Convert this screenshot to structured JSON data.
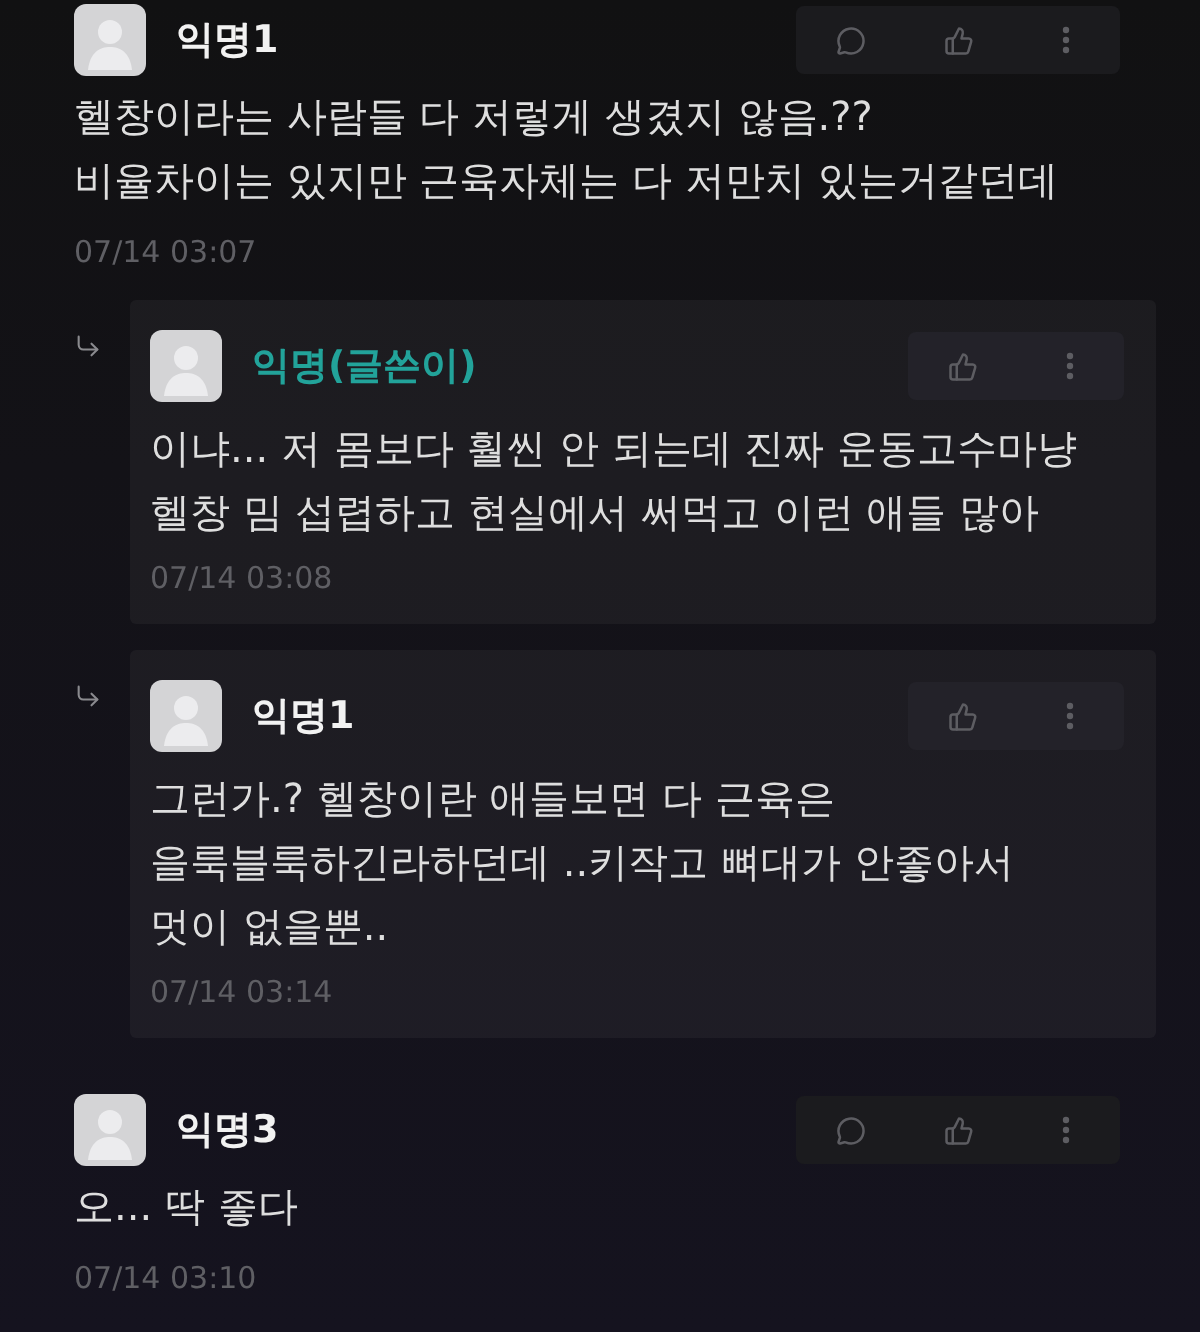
{
  "comments": [
    {
      "author": "익명1",
      "writer": false,
      "text": "헬창이라는 사람들 다 저렇게 생겼지 않음.??\n비율차이는 있지만 근육자체는 다 저만치 있는거같던데",
      "time": "07/14 03:07",
      "actions": [
        {
          "kind": "reply"
        },
        {
          "kind": "like"
        },
        {
          "kind": "more"
        }
      ],
      "replies": [
        {
          "author": "익명(글쓴이)",
          "writer": true,
          "text": "이냐... 저 몸보다 훨씬 안 되는데 진짜 운동고수마냥\n헬창 밈 섭렵하고 현실에서 써먹고 이런 애들 많아",
          "time": "07/14 03:08",
          "actions": [
            {
              "kind": "like"
            },
            {
              "kind": "more"
            }
          ]
        },
        {
          "author": "익명1",
          "writer": false,
          "text": "그런가.? 헬창이란 애들보면 다 근육은\n을룩블룩하긴라하던데 ..키작고 뼈대가 안좋아서\n멋이 없을뿐..",
          "time": "07/14 03:14",
          "actions": [
            {
              "kind": "like"
            },
            {
              "kind": "more"
            }
          ]
        }
      ]
    },
    {
      "author": "익명3",
      "writer": false,
      "text": "오... 딱 좋다",
      "time": "07/14 03:10",
      "actions": [
        {
          "kind": "reply"
        },
        {
          "kind": "like"
        },
        {
          "kind": "more"
        }
      ]
    }
  ]
}
